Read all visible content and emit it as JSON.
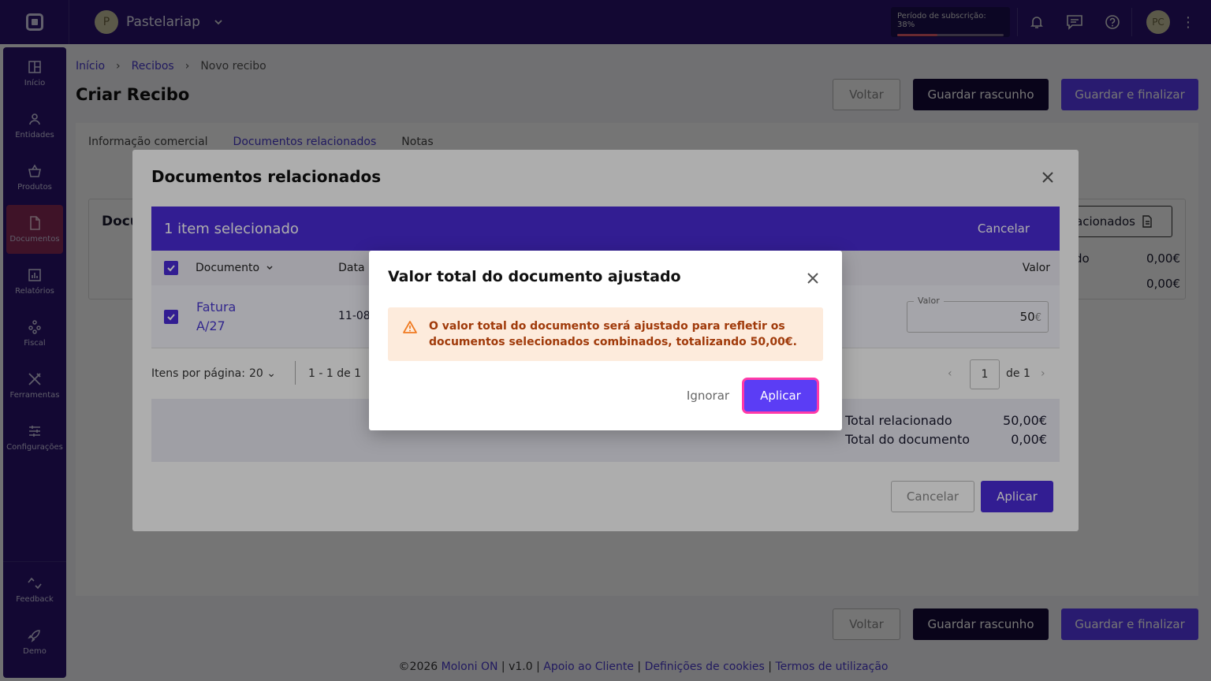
{
  "topbar": {
    "company_initial": "P",
    "company_name": "Pastelariap",
    "subscription_label": "Período de subscrição: 38%",
    "subscription_progress": 0.38,
    "user_initials": "PC"
  },
  "sidebar": {
    "items": [
      {
        "label": "Início",
        "icon": "grid-icon"
      },
      {
        "label": "Entidades",
        "icon": "user-icon"
      },
      {
        "label": "Produtos",
        "icon": "basket-icon"
      },
      {
        "label": "Documentos",
        "icon": "document-icon",
        "active": true
      },
      {
        "label": "Relatórios",
        "icon": "chart-icon"
      },
      {
        "label": "Fiscal",
        "icon": "fiscal-icon"
      },
      {
        "label": "Ferramentas",
        "icon": "tools-icon"
      },
      {
        "label": "Configurações",
        "icon": "sliders-icon"
      }
    ],
    "bottom": [
      {
        "label": "Feedback",
        "icon": "feedback-icon"
      },
      {
        "label": "Demo",
        "icon": "rocket-icon"
      }
    ]
  },
  "page": {
    "breadcrumb": [
      "Início",
      "Recibos",
      "Novo recibo"
    ],
    "title": "Criar Recibo",
    "btn_back": "Voltar",
    "btn_draft": "Guardar rascunho",
    "btn_finalize": "Guardar e finalizar",
    "tabs": [
      "Informação comercial",
      "Documentos relacionados",
      "Notas"
    ],
    "bg_section_title": "Docu",
    "bg_related_btn": "acionados",
    "bg_row1_label": "do",
    "bg_row1_value": "0,00€",
    "bg_row2_value": "0,00€"
  },
  "footer": {
    "copyright": "©2026",
    "brand": "Moloni ON",
    "version": "v1.0",
    "links": [
      "Apoio ao Cliente",
      "Definições de cookies",
      "Termos de utilização"
    ]
  },
  "related_dialog": {
    "title": "Documentos relacionados",
    "selection_text": "1 item selecionado",
    "selection_cancel": "Cancelar",
    "columns": {
      "documento": "Documento",
      "data": "Data",
      "valor": "Valor"
    },
    "row": {
      "doc_line1": "Fatura",
      "doc_line2": "A/27",
      "date": "11-08-",
      "value_label": "Valor",
      "value": "50",
      "currency": "€"
    },
    "pagination": {
      "items_per_page_label": "Itens por página:",
      "items_per_page": "20",
      "range": "1 - 1 de 1",
      "page": "1",
      "of": "de 1"
    },
    "totals": {
      "related_label": "Total relacionado",
      "related_value": "50,00€",
      "document_label": "Total do documento",
      "document_value": "0,00€"
    },
    "btn_cancel": "Cancelar",
    "btn_apply": "Aplicar"
  },
  "confirm_dialog": {
    "title": "Valor total do documento ajustado",
    "message": "O valor total do documento será ajustado para refletir os documentos selecionados combinados, totalizando 50,00€.",
    "btn_ignore": "Ignorar",
    "btn_apply": "Aplicar"
  },
  "colors": {
    "brand": "#2a1470",
    "primary": "#5b3df5",
    "highlight": "#ff3aa8",
    "warning_bg": "#fdebdc",
    "warning_text": "#a03a0a"
  }
}
